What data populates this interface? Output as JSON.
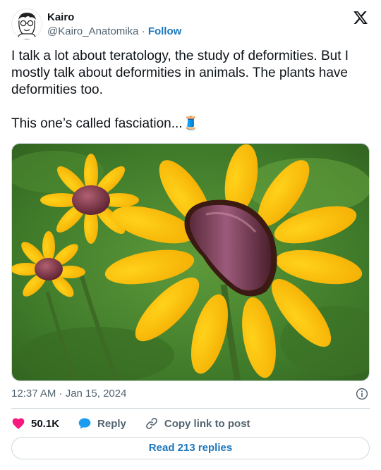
{
  "author": {
    "display_name": "Kairo",
    "handle": "@Kairo_Anatomika",
    "separator": "·",
    "follow_label": "Follow"
  },
  "tweet": {
    "text": "I talk a lot about teratology, the study of deformities. But I mostly talk about deformities in animals. The plants have deformities too.\n\nThis one’s called fasciation...🧵"
  },
  "meta": {
    "timestamp": "12:37 AM · Jan 15, 2024"
  },
  "actions": {
    "likes": "50.1K",
    "reply_label": "Reply",
    "copy_label": "Copy link to post"
  },
  "replies_button": "Read 213 replies",
  "colors": {
    "link": "#1d77bd",
    "heart": "#f91880",
    "reply_bubble": "#1d9bf0",
    "muted": "#536471",
    "border": "#cfd9de"
  },
  "icons": [
    "x-logo-icon",
    "info-icon",
    "heart-icon",
    "reply-bubble-icon",
    "link-icon"
  ]
}
